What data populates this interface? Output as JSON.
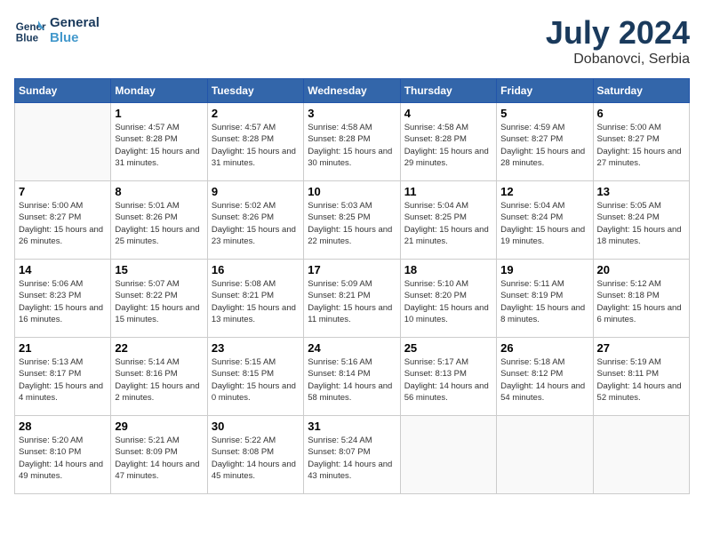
{
  "logo": {
    "line1": "General",
    "line2": "Blue"
  },
  "title": {
    "month_year": "July 2024",
    "location": "Dobanovci, Serbia"
  },
  "headers": [
    "Sunday",
    "Monday",
    "Tuesday",
    "Wednesday",
    "Thursday",
    "Friday",
    "Saturday"
  ],
  "weeks": [
    [
      {
        "day": "",
        "sunrise": "",
        "sunset": "",
        "daylight": ""
      },
      {
        "day": "1",
        "sunrise": "Sunrise: 4:57 AM",
        "sunset": "Sunset: 8:28 PM",
        "daylight": "Daylight: 15 hours and 31 minutes."
      },
      {
        "day": "2",
        "sunrise": "Sunrise: 4:57 AM",
        "sunset": "Sunset: 8:28 PM",
        "daylight": "Daylight: 15 hours and 31 minutes."
      },
      {
        "day": "3",
        "sunrise": "Sunrise: 4:58 AM",
        "sunset": "Sunset: 8:28 PM",
        "daylight": "Daylight: 15 hours and 30 minutes."
      },
      {
        "day": "4",
        "sunrise": "Sunrise: 4:58 AM",
        "sunset": "Sunset: 8:28 PM",
        "daylight": "Daylight: 15 hours and 29 minutes."
      },
      {
        "day": "5",
        "sunrise": "Sunrise: 4:59 AM",
        "sunset": "Sunset: 8:27 PM",
        "daylight": "Daylight: 15 hours and 28 minutes."
      },
      {
        "day": "6",
        "sunrise": "Sunrise: 5:00 AM",
        "sunset": "Sunset: 8:27 PM",
        "daylight": "Daylight: 15 hours and 27 minutes."
      }
    ],
    [
      {
        "day": "7",
        "sunrise": "Sunrise: 5:00 AM",
        "sunset": "Sunset: 8:27 PM",
        "daylight": "Daylight: 15 hours and 26 minutes."
      },
      {
        "day": "8",
        "sunrise": "Sunrise: 5:01 AM",
        "sunset": "Sunset: 8:26 PM",
        "daylight": "Daylight: 15 hours and 25 minutes."
      },
      {
        "day": "9",
        "sunrise": "Sunrise: 5:02 AM",
        "sunset": "Sunset: 8:26 PM",
        "daylight": "Daylight: 15 hours and 23 minutes."
      },
      {
        "day": "10",
        "sunrise": "Sunrise: 5:03 AM",
        "sunset": "Sunset: 8:25 PM",
        "daylight": "Daylight: 15 hours and 22 minutes."
      },
      {
        "day": "11",
        "sunrise": "Sunrise: 5:04 AM",
        "sunset": "Sunset: 8:25 PM",
        "daylight": "Daylight: 15 hours and 21 minutes."
      },
      {
        "day": "12",
        "sunrise": "Sunrise: 5:04 AM",
        "sunset": "Sunset: 8:24 PM",
        "daylight": "Daylight: 15 hours and 19 minutes."
      },
      {
        "day": "13",
        "sunrise": "Sunrise: 5:05 AM",
        "sunset": "Sunset: 8:24 PM",
        "daylight": "Daylight: 15 hours and 18 minutes."
      }
    ],
    [
      {
        "day": "14",
        "sunrise": "Sunrise: 5:06 AM",
        "sunset": "Sunset: 8:23 PM",
        "daylight": "Daylight: 15 hours and 16 minutes."
      },
      {
        "day": "15",
        "sunrise": "Sunrise: 5:07 AM",
        "sunset": "Sunset: 8:22 PM",
        "daylight": "Daylight: 15 hours and 15 minutes."
      },
      {
        "day": "16",
        "sunrise": "Sunrise: 5:08 AM",
        "sunset": "Sunset: 8:21 PM",
        "daylight": "Daylight: 15 hours and 13 minutes."
      },
      {
        "day": "17",
        "sunrise": "Sunrise: 5:09 AM",
        "sunset": "Sunset: 8:21 PM",
        "daylight": "Daylight: 15 hours and 11 minutes."
      },
      {
        "day": "18",
        "sunrise": "Sunrise: 5:10 AM",
        "sunset": "Sunset: 8:20 PM",
        "daylight": "Daylight: 15 hours and 10 minutes."
      },
      {
        "day": "19",
        "sunrise": "Sunrise: 5:11 AM",
        "sunset": "Sunset: 8:19 PM",
        "daylight": "Daylight: 15 hours and 8 minutes."
      },
      {
        "day": "20",
        "sunrise": "Sunrise: 5:12 AM",
        "sunset": "Sunset: 8:18 PM",
        "daylight": "Daylight: 15 hours and 6 minutes."
      }
    ],
    [
      {
        "day": "21",
        "sunrise": "Sunrise: 5:13 AM",
        "sunset": "Sunset: 8:17 PM",
        "daylight": "Daylight: 15 hours and 4 minutes."
      },
      {
        "day": "22",
        "sunrise": "Sunrise: 5:14 AM",
        "sunset": "Sunset: 8:16 PM",
        "daylight": "Daylight: 15 hours and 2 minutes."
      },
      {
        "day": "23",
        "sunrise": "Sunrise: 5:15 AM",
        "sunset": "Sunset: 8:15 PM",
        "daylight": "Daylight: 15 hours and 0 minutes."
      },
      {
        "day": "24",
        "sunrise": "Sunrise: 5:16 AM",
        "sunset": "Sunset: 8:14 PM",
        "daylight": "Daylight: 14 hours and 58 minutes."
      },
      {
        "day": "25",
        "sunrise": "Sunrise: 5:17 AM",
        "sunset": "Sunset: 8:13 PM",
        "daylight": "Daylight: 14 hours and 56 minutes."
      },
      {
        "day": "26",
        "sunrise": "Sunrise: 5:18 AM",
        "sunset": "Sunset: 8:12 PM",
        "daylight": "Daylight: 14 hours and 54 minutes."
      },
      {
        "day": "27",
        "sunrise": "Sunrise: 5:19 AM",
        "sunset": "Sunset: 8:11 PM",
        "daylight": "Daylight: 14 hours and 52 minutes."
      }
    ],
    [
      {
        "day": "28",
        "sunrise": "Sunrise: 5:20 AM",
        "sunset": "Sunset: 8:10 PM",
        "daylight": "Daylight: 14 hours and 49 minutes."
      },
      {
        "day": "29",
        "sunrise": "Sunrise: 5:21 AM",
        "sunset": "Sunset: 8:09 PM",
        "daylight": "Daylight: 14 hours and 47 minutes."
      },
      {
        "day": "30",
        "sunrise": "Sunrise: 5:22 AM",
        "sunset": "Sunset: 8:08 PM",
        "daylight": "Daylight: 14 hours and 45 minutes."
      },
      {
        "day": "31",
        "sunrise": "Sunrise: 5:24 AM",
        "sunset": "Sunset: 8:07 PM",
        "daylight": "Daylight: 14 hours and 43 minutes."
      },
      {
        "day": "",
        "sunrise": "",
        "sunset": "",
        "daylight": ""
      },
      {
        "day": "",
        "sunrise": "",
        "sunset": "",
        "daylight": ""
      },
      {
        "day": "",
        "sunrise": "",
        "sunset": "",
        "daylight": ""
      }
    ]
  ]
}
